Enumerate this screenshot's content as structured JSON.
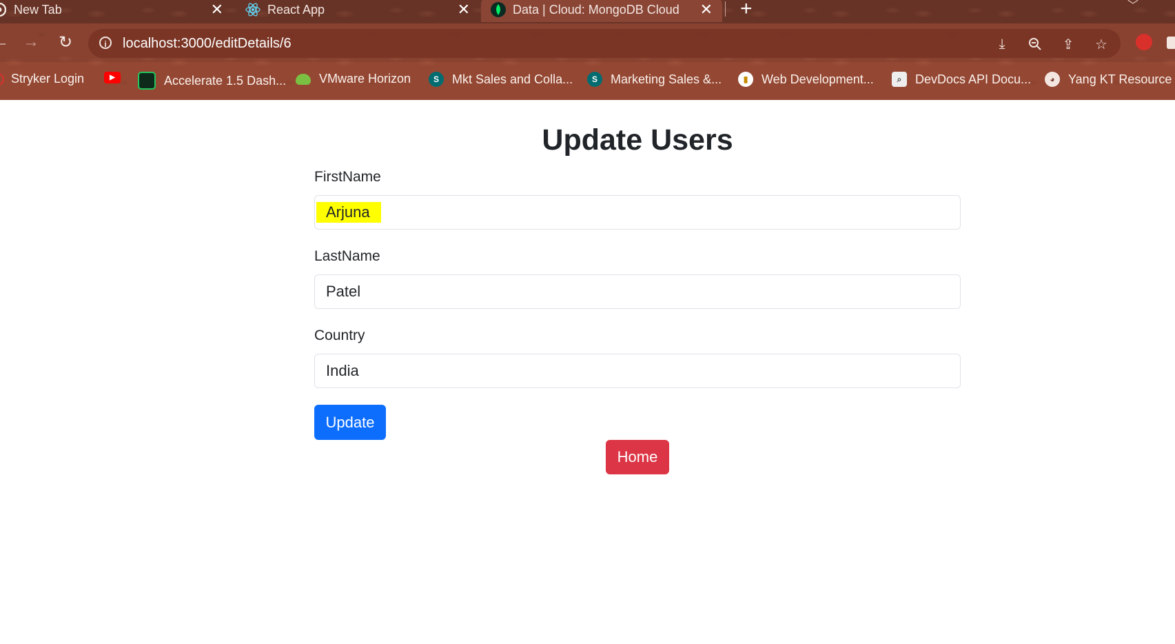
{
  "browser": {
    "tabs": [
      {
        "title": "New Tab",
        "favicon": "chrome-icon"
      },
      {
        "title": "React App",
        "favicon": "react-icon"
      },
      {
        "title": "Data | Cloud: MongoDB Cloud",
        "favicon": "mongodb-leaf-icon"
      }
    ],
    "address": "localhost:3000/editDetails/6",
    "bookmarks": [
      {
        "label": "Stryker Login",
        "icon": "globe-icon"
      },
      {
        "label": "",
        "icon": "youtube-icon"
      },
      {
        "label": "Accelerate 1.5 Dash...",
        "icon": "accelerate-icon"
      },
      {
        "label": "VMware Horizon",
        "icon": "cloud-icon"
      },
      {
        "label": "Mkt Sales and Colla...",
        "icon": "sharepoint-icon"
      },
      {
        "label": "Marketing Sales &...",
        "icon": "sharepoint-icon"
      },
      {
        "label": "Web Development...",
        "icon": "bookmark-icon"
      },
      {
        "label": "DevDocs API Docu...",
        "icon": "devdocs-icon"
      },
      {
        "label": "Yang KT Resource",
        "icon": "globe-icon"
      }
    ],
    "colors": {
      "chrome": "#7a3f30",
      "accent_red": "#d9302c"
    }
  },
  "page": {
    "title": "Update Users",
    "fields": [
      {
        "label": "FirstName",
        "value": "Arjuna",
        "highlighted": true
      },
      {
        "label": "LastName",
        "value": "Patel"
      },
      {
        "label": "Country",
        "value": "India"
      }
    ],
    "update_button": "Update",
    "home_button": "Home",
    "colors": {
      "primary": "#0d6efd",
      "danger": "#dc3545",
      "highlight": "#ffff00"
    }
  }
}
